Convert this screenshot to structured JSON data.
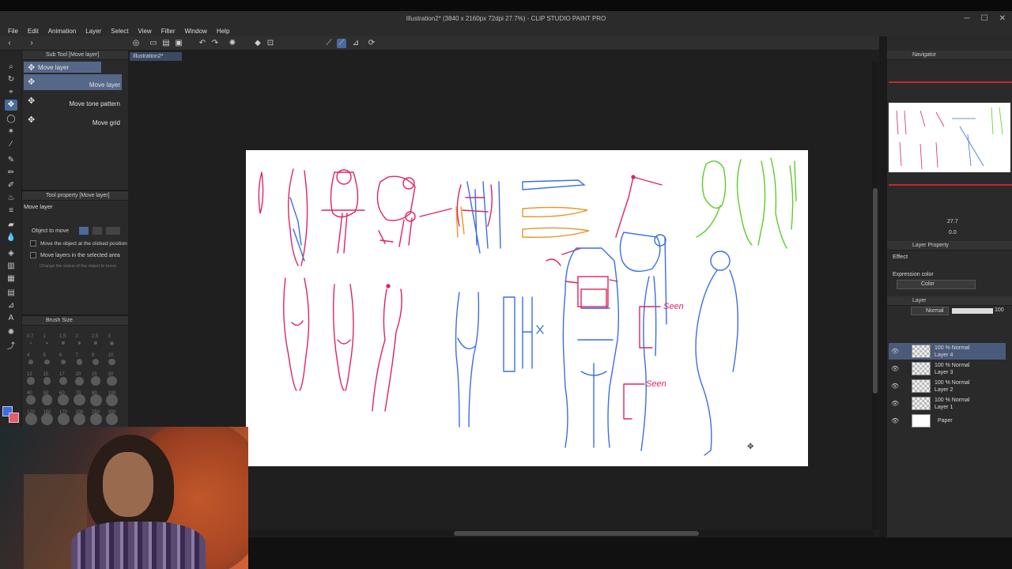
{
  "window": {
    "title": "Illustration2* (3840 x 2160px 72dpi 27.7%) - CLIP STUDIO PAINT PRO"
  },
  "menu": [
    "File",
    "Edit",
    "Animation",
    "Layer",
    "Select",
    "View",
    "Filter",
    "Window",
    "Help"
  ],
  "document_tab": "Illustration2*",
  "sub_tool": {
    "header": "Sub Tool [Move layer]",
    "group_label": "Move layer",
    "items": [
      "Move layer",
      "Move tone pattern",
      "Move grid"
    ]
  },
  "tool_property": {
    "header": "Tool property [Move layer]",
    "name": "Move layer",
    "object_to_move_label": "Object to move",
    "options": [
      "Move the object at the clicked position",
      "Move layers in the selected area",
      "Change the status of the object to move"
    ]
  },
  "brush_size": {
    "header": "Brush Size",
    "labels": [
      "0.7",
      "1",
      "1.5",
      "2",
      "2.5",
      "3",
      "4",
      "5",
      "6",
      "7",
      "8",
      "10",
      "12",
      "15",
      "17",
      "20",
      "25",
      "30",
      "40",
      "50",
      "60",
      "70",
      "80",
      "100",
      "120",
      "150",
      "170",
      "200",
      "250",
      "300"
    ]
  },
  "navigator": {
    "header": "Navigator",
    "zoom": "27.7",
    "rotation": "0.0"
  },
  "layer_property": {
    "header": "Layer Property",
    "effect_label": "Effect",
    "expression_color_label": "Expression color",
    "expression_color_value": "Color"
  },
  "layer_panel": {
    "header": "Layer",
    "blend_mode": "Normal",
    "opacity": "100",
    "layers": [
      {
        "line1": "100 % Normal",
        "line2": "Layer 4",
        "selected": true
      },
      {
        "line1": "100 % Normal",
        "line2": "Layer 3",
        "selected": false
      },
      {
        "line1": "100 % Normal",
        "line2": "Layer 2",
        "selected": false
      },
      {
        "line1": "100 % Normal",
        "line2": "Layer 1",
        "selected": false
      },
      {
        "line1": "",
        "line2": "Paper",
        "selected": false,
        "paper": true
      }
    ]
  },
  "sketch_annotations": [
    "Seen",
    "Seen"
  ],
  "colors": {
    "accent": "#4a6a9a",
    "sketch_red": "#e0245e",
    "sketch_blue": "#3a6ee8",
    "sketch_green": "#5ccc2a",
    "sketch_orange": "#e8932a"
  }
}
